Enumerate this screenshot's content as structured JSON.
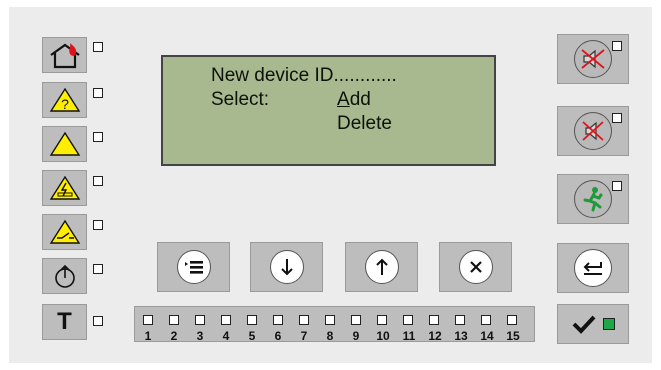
{
  "lcd": {
    "line1": "New device ID............",
    "line2_label": "Select:",
    "option_add_first": "A",
    "option_add_rest": "dd",
    "option_delete": "Delete"
  },
  "zones": [
    "1",
    "2",
    "3",
    "4",
    "5",
    "6",
    "7",
    "8",
    "9",
    "10",
    "11",
    "12",
    "13",
    "14",
    "15"
  ],
  "left_buttons": [
    {
      "name": "fire-alarm",
      "icon": "house-fire-icon"
    },
    {
      "name": "warning-question",
      "icon": "warning-question-icon"
    },
    {
      "name": "warning",
      "icon": "warning-triangle-icon"
    },
    {
      "name": "fault-electric",
      "icon": "electric-fault-icon"
    },
    {
      "name": "disablement",
      "icon": "switch-off-icon"
    },
    {
      "name": "power",
      "icon": "power-icon"
    },
    {
      "name": "test",
      "icon": "test-icon",
      "label": "T"
    }
  ],
  "nav_buttons": [
    {
      "name": "menu",
      "icon": "menu-icon"
    },
    {
      "name": "down",
      "icon": "arrow-down-icon"
    },
    {
      "name": "up",
      "icon": "arrow-up-icon"
    },
    {
      "name": "cancel",
      "icon": "close-icon"
    }
  ],
  "right_buttons": [
    {
      "name": "mute-sounder",
      "icon": "speaker-muted-icon"
    },
    {
      "name": "mute-buzzer",
      "icon": "speaker-crossed-icon"
    },
    {
      "name": "evacuate",
      "icon": "running-man-icon"
    },
    {
      "name": "back",
      "icon": "return-icon"
    },
    {
      "name": "confirm",
      "icon": "check-icon"
    }
  ],
  "colors": {
    "panel": "#ececec",
    "button": "#bdbdbd",
    "lcd": "#a9b98f",
    "led_ok": "#1ea84a",
    "fire": "#e0131a",
    "warning_yellow": "#ffee00",
    "evac_green": "#1f9a3a"
  }
}
